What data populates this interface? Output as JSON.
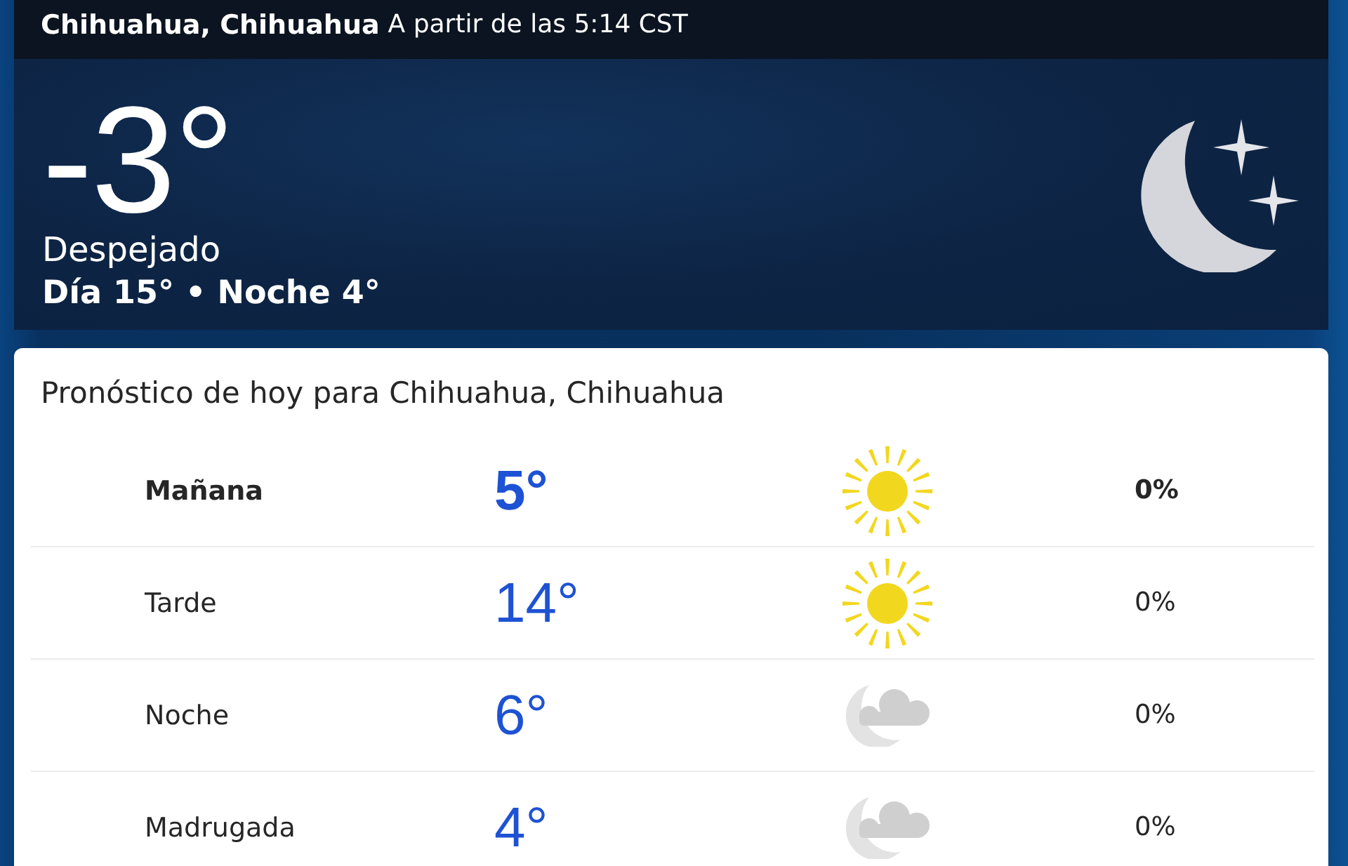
{
  "header": {
    "location": "Chihuahua, Chihuahua",
    "updated": "A partir de las 5:14 CST"
  },
  "current": {
    "temperature": "-3°",
    "condition": "Despejado",
    "day_night": "Día 15° • Noche 4°",
    "kind": "clear-night"
  },
  "forecast": {
    "title": "Pronóstico de hoy para Chihuahua, Chihuahua",
    "rows": [
      {
        "period": "Mañana",
        "temperature": "5°",
        "kind": "sunny",
        "precipitation": "0%",
        "selected": true
      },
      {
        "period": "Tarde",
        "temperature": "14°",
        "kind": "sunny",
        "precipitation": "0%",
        "selected": false
      },
      {
        "period": "Noche",
        "temperature": "6°",
        "kind": "cloudy-night",
        "precipitation": "0%",
        "selected": false
      },
      {
        "period": "Madrugada",
        "temperature": "4°",
        "kind": "cloudy-night",
        "precipitation": "0%",
        "selected": false
      }
    ]
  }
}
